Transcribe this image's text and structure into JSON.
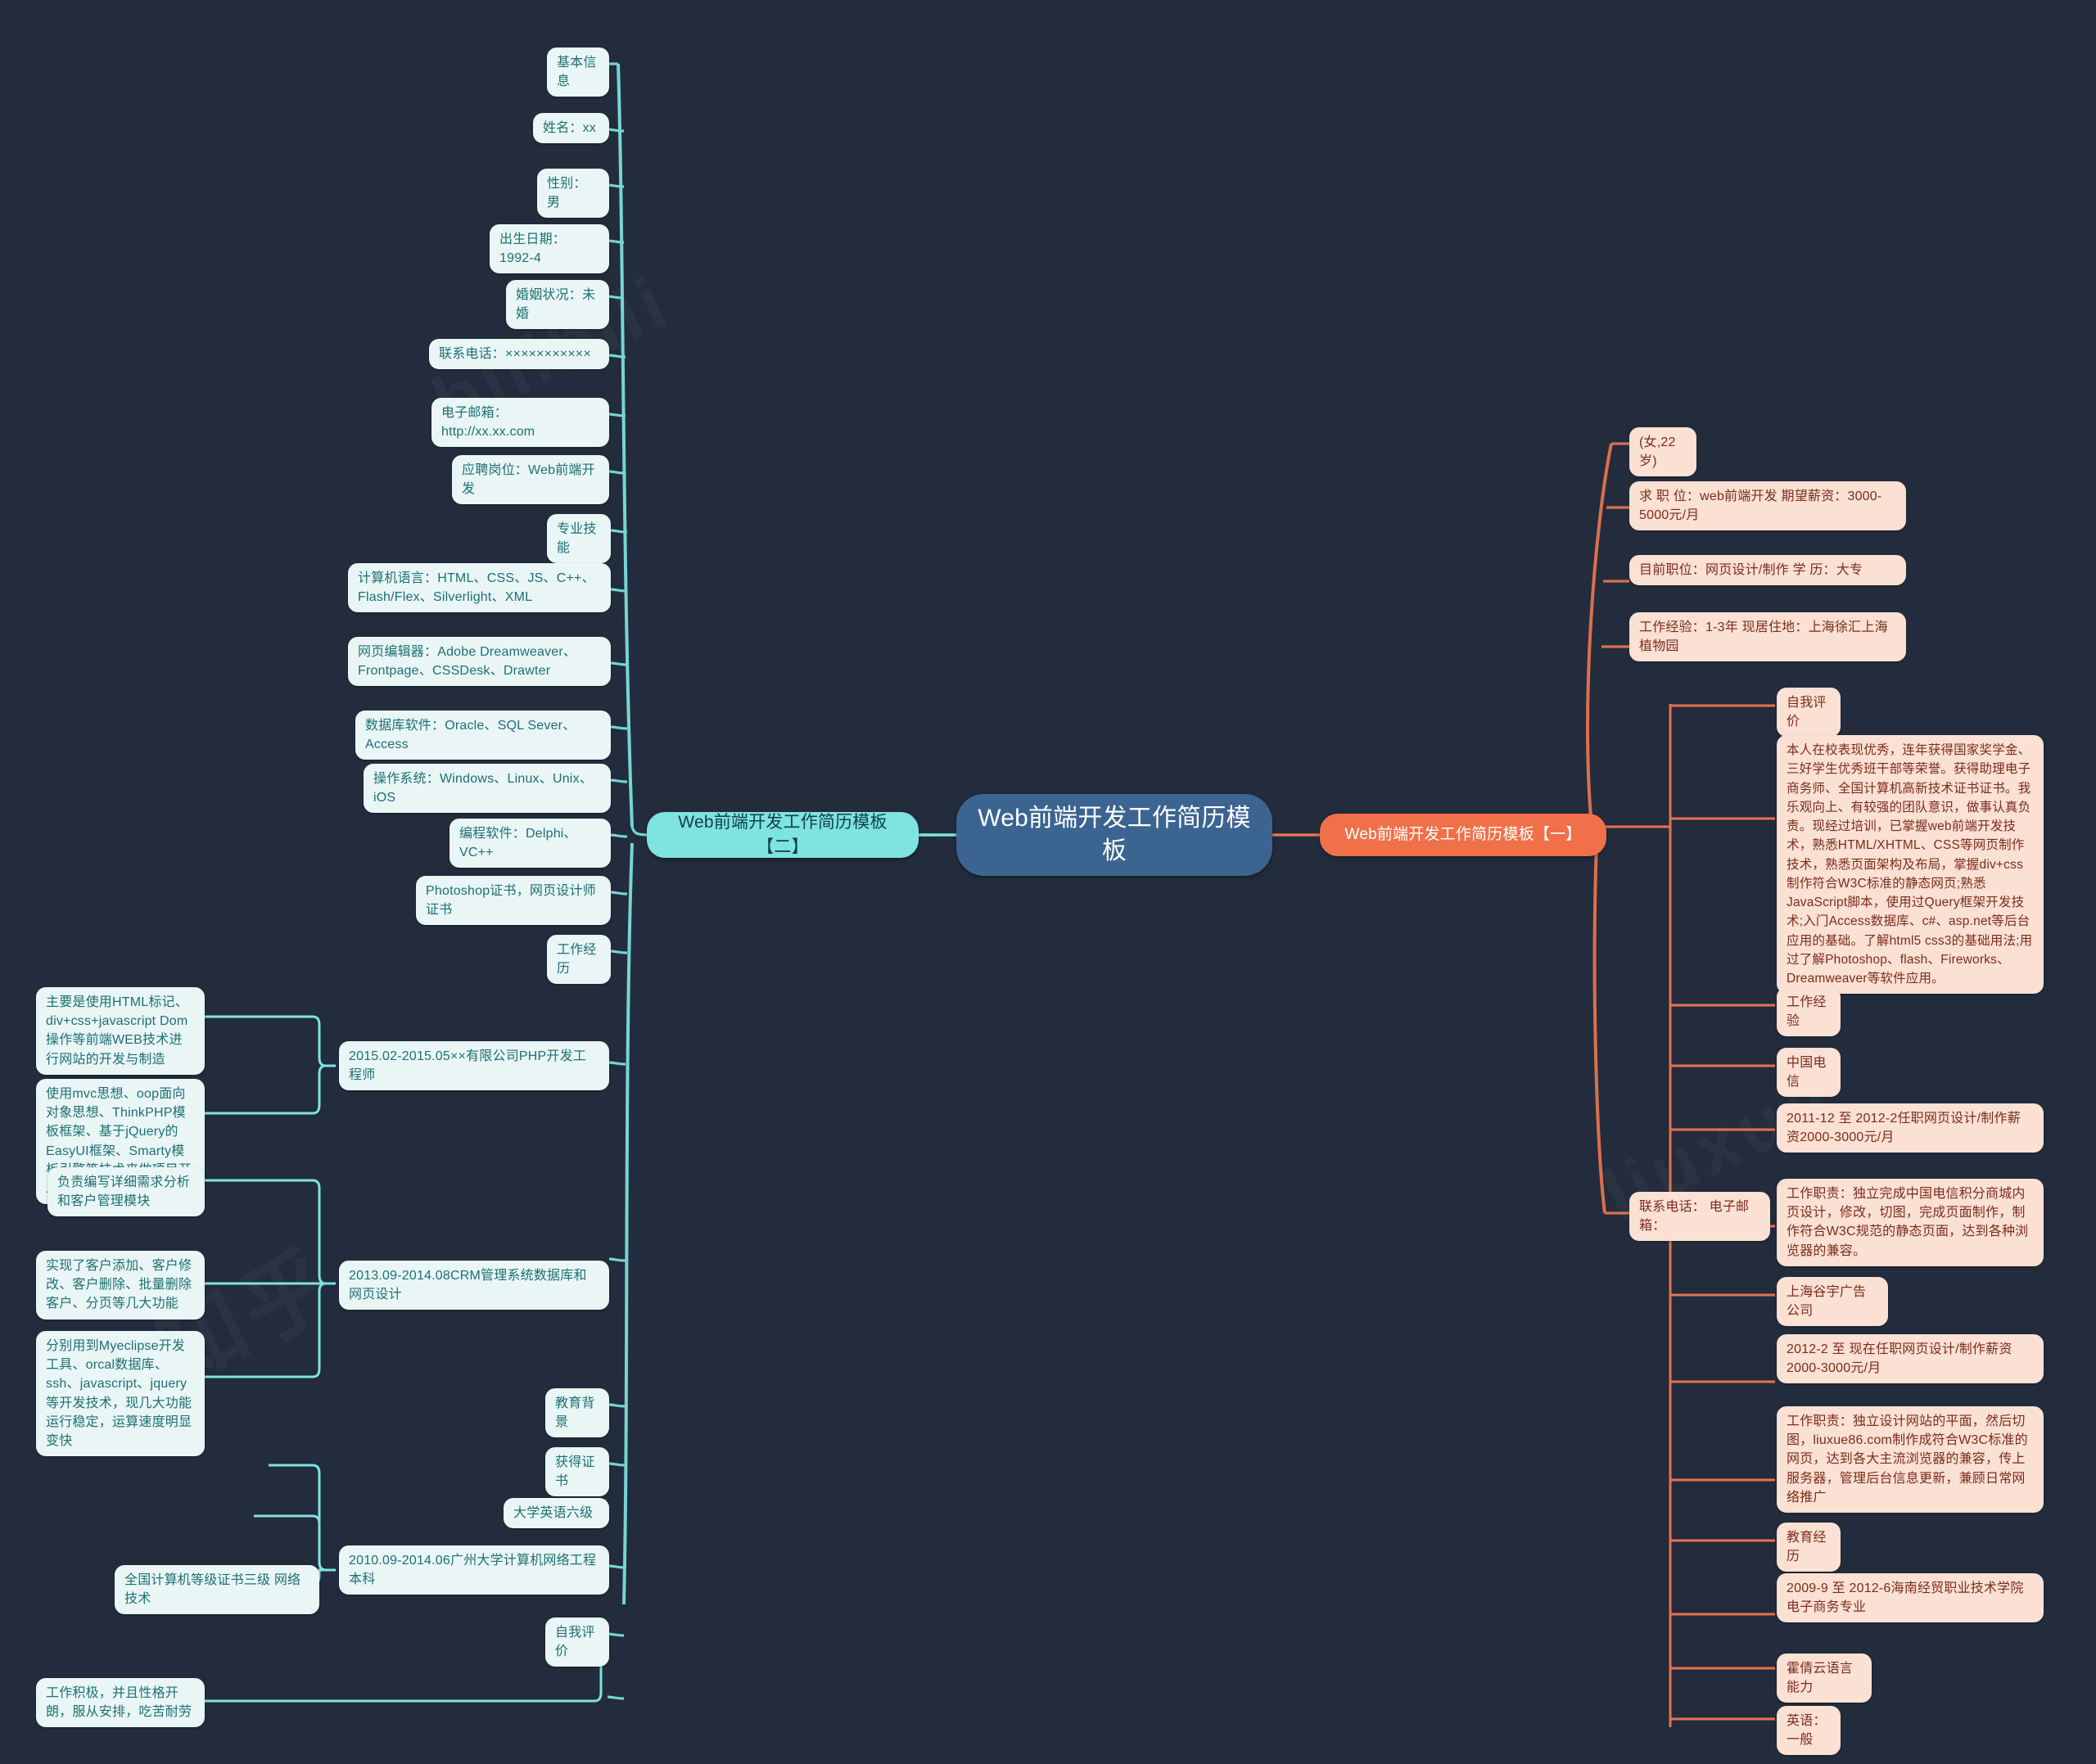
{
  "theme": {
    "canvas_bg": "#222c3c",
    "root_fill": "#3c6491",
    "left_branch_fill": "#7fe3e0",
    "right_branch_fill": "#f0704a",
    "left_node_fill": "#e9f6f5",
    "left_node_text": "#1e6f72",
    "right_node_fill": "#fbe0d4",
    "right_node_text": "#7b2d1a",
    "left_link_color": "#7fe3e0",
    "right_link_color": "#e5734f"
  },
  "root": {
    "label": "Web前端开发工作简历模板"
  },
  "left_branch": {
    "label": "Web前端开发工作简历模板【二】",
    "groups": [
      {
        "heading": "基本信息",
        "items": [
          "姓名：xx",
          "性别：男",
          "出生日期：1992-4",
          "婚姻状况：未婚",
          "联系电话：×××××××××××",
          "电子邮箱：http://xx.xx.com",
          "应聘岗位：Web前端开发"
        ]
      },
      {
        "heading": "专业技能",
        "items": [
          "计算机语言：HTML、CSS、JS、C++、Flash/Flex、Silverlight、XML",
          "网页编辑器：Adobe Dreamweaver、Frontpage、CSSDesk、Drawter",
          "数据库软件：Oracle、SQL Sever、Access",
          "操作系统：Windows、Linux、Unix、iOS",
          "编程软件：Delphi、VC++",
          "Photoshop证书，网页设计师证书"
        ]
      },
      {
        "heading": "工作经历",
        "jobs": [
          {
            "title": "2015.02-2015.05××有限公司PHP开发工程师",
            "details": [
              "主要是使用HTML标记、div+css+javascript Dom操作等前端WEB技术进行网站的开发与制造",
              "使用mvc思想、oop面向对象思想、ThinkPHP模板框架、基于jQuery的EasyUI框架、Smarty模板引擎等技术来做项目开发"
            ]
          },
          {
            "title": "2013.09-2014.08CRM管理系统数据库和网页设计",
            "details": [
              "负责编写详细需求分析和客户管理模块",
              "实现了客户添加、客户修改、客户删除、批量删除客户、分页等几大功能",
              "分别用到Myeclipse开发工具、orcal数据库、ssh、javascript、jquery等开发技术，现几大功能运行稳定，运算速度明显变快"
            ]
          }
        ]
      },
      {
        "heading": "教育背景",
        "school": "2010.09-2014.06广州大学计算机网络工程本科",
        "certs_heading": "获得证书",
        "certs": [
          "大学英语六级",
          "全国计算机等级证书三级 网络技术"
        ]
      },
      {
        "heading": "自我评价",
        "items": [
          "工作积极，并且性格开朗，服从安排，吃苦耐劳"
        ]
      }
    ]
  },
  "right_branch": {
    "label": "Web前端开发工作简历模板【一】",
    "profile": [
      "(女,22岁)",
      "求 职 位：web前端开发 期望薪资：3000-5000元/月",
      "目前职位：网页设计/制作 学 历：大专",
      "工作经验：1-3年 现居住地：上海徐汇上海植物园"
    ],
    "contact": "联系电话：  电子邮箱：",
    "sections": [
      {
        "heading": "自我评价",
        "items": [
          "本人在校表现优秀，连年获得国家奖学金、三好学生优秀班干部等荣誉。获得助理电子商务师、全国计算机高新技术证书证书。我乐观向上、有较强的团队意识，做事认真负责。现经过培训，已掌握web前端开发技术，熟悉HTML/XHTML、CSS等网页制作技术，熟悉页面架构及布局，掌握div+css制作符合W3C标准的静态网页;熟悉JavaScript脚本，使用过Query框架开发技术;入门Access数据库、c#、asp.net等后台应用的基础。了解html5 css3的基础用法;用过了解Photoshop、flash、Fireworks、Dreamweaver等软件应用。"
        ]
      },
      {
        "heading": "工作经验",
        "items": [
          "中国电信",
          "2011-12 至 2012-2任职网页设计/制作薪资2000-3000元/月",
          "工作职责：独立完成中国电信积分商城内页设计，修改，切图，完成页面制作，制作符合W3C规范的静态页面，达到各种浏览器的兼容。",
          "上海谷宇广告公司",
          "2012-2 至 现在任职网页设计/制作薪资2000-3000元/月",
          "工作职责：独立设计网站的平面，然后切图，liuxue86.com制作成符合W3C标准的网页，达到各大主流浏览器的兼容，传上服务器，管理后台信息更新，兼顾日常网络推广"
        ]
      },
      {
        "heading": "教育经历",
        "items": [
          "2009-9 至 2012-6海南经贸职业技术学院电子商务专业"
        ]
      },
      {
        "heading": "霍倩云语言能力",
        "items": [
          "英语：一般"
        ]
      }
    ]
  }
}
